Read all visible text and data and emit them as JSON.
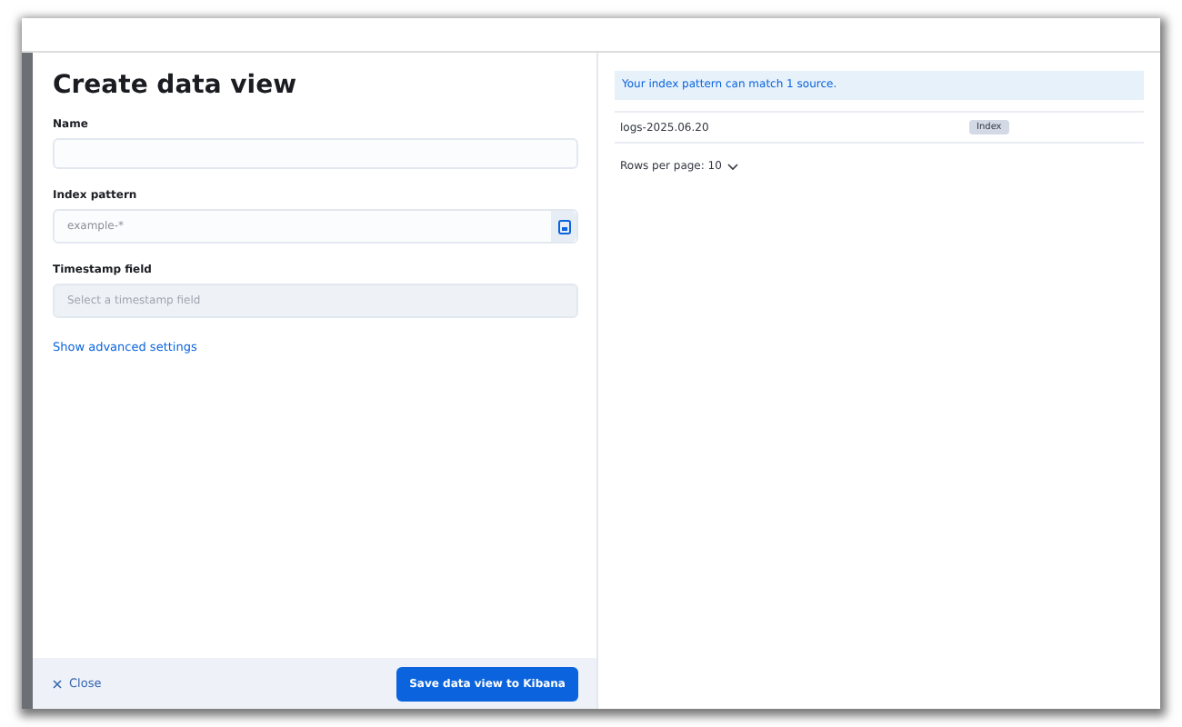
{
  "flyout": {
    "title": "Create data view",
    "fields": [
      {
        "label": "Name",
        "kind": "text"
      },
      {
        "label": "Index pattern",
        "kind": "pattern",
        "placeholder": "example-*"
      },
      {
        "label": "Timestamp field",
        "kind": "select",
        "placeholder": "Select a timestamp field",
        "disabled": true
      }
    ],
    "advanced_link": "Show advanced settings",
    "footer": {
      "close": "Close",
      "save": "Save data view to Kibana"
    }
  },
  "results": {
    "callout": "Your index pattern can match 1 source.",
    "rows": [
      {
        "name": "logs-2025.06.20",
        "badge": "Index"
      }
    ],
    "rows_per_page": "Rows per page: 10"
  }
}
